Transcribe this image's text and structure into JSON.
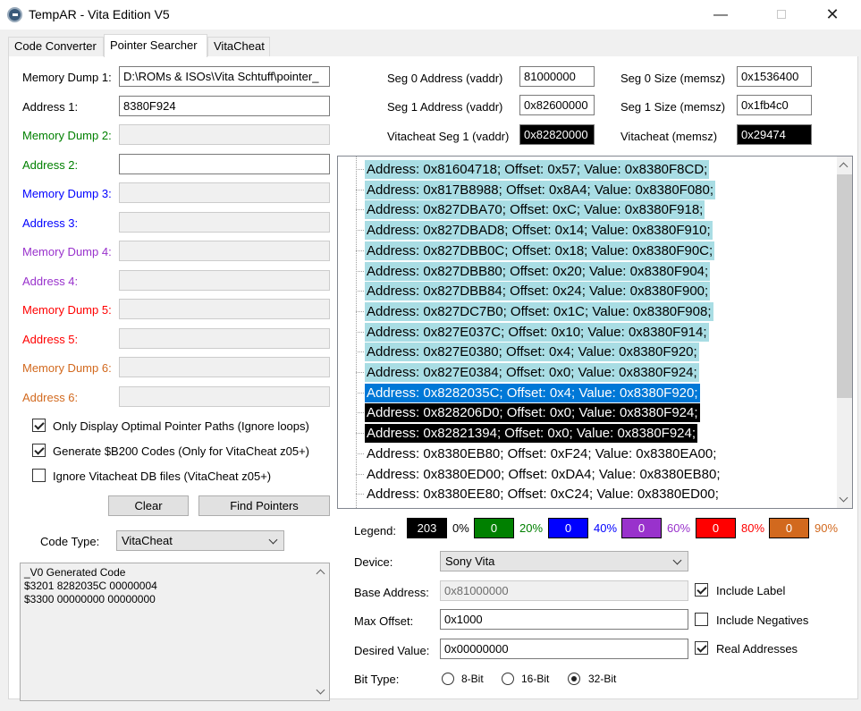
{
  "window": {
    "title": "TempAR - Vita Edition  V5",
    "minimize": "—",
    "close": "✕"
  },
  "tabs": [
    "Code Converter",
    "Pointer Searcher",
    "VitaCheat"
  ],
  "left": {
    "rows": [
      {
        "label": "Memory Dump 1:",
        "value": "D:\\ROMs & ISOs\\Vita Schtuff\\pointer_",
        "color": "#000000",
        "disabled": false
      },
      {
        "label": "Address 1:",
        "value": "8380F924",
        "color": "#000000",
        "disabled": false
      },
      {
        "label": "Memory Dump 2:",
        "value": "",
        "color": "#008000",
        "disabled": true
      },
      {
        "label": "Address 2:",
        "value": "",
        "color": "#008000",
        "disabled": false
      },
      {
        "label": "Memory Dump 3:",
        "value": "",
        "color": "#0000ff",
        "disabled": true
      },
      {
        "label": "Address 3:",
        "value": "",
        "color": "#0000ff",
        "disabled": true
      },
      {
        "label": "Memory Dump 4:",
        "value": "",
        "color": "#9932cc",
        "disabled": true
      },
      {
        "label": "Address 4:",
        "value": "",
        "color": "#9932cc",
        "disabled": true
      },
      {
        "label": "Memory Dump 5:",
        "value": "",
        "color": "#ff0000",
        "disabled": true
      },
      {
        "label": "Address 5:",
        "value": "",
        "color": "#ff0000",
        "disabled": true
      },
      {
        "label": "Memory Dump 6:",
        "value": "",
        "color": "#d2691e",
        "disabled": true
      },
      {
        "label": "Address 6:",
        "value": "",
        "color": "#d2691e",
        "disabled": true
      }
    ],
    "checkboxes": [
      {
        "label": "Only Display Optimal Pointer Paths (Ignore loops)",
        "checked": true
      },
      {
        "label": "Generate $B200 Codes (Only for VitaCheat z05+)",
        "checked": true
      },
      {
        "label": "Ignore Vitacheat DB files (VitaCheat z05+)",
        "checked": false
      }
    ],
    "clear_label": "Clear",
    "find_label": "Find Pointers",
    "code_type_label": "Code Type:",
    "code_type_value": "VitaCheat",
    "code_output": "_V0 Generated Code\n$3201 8282035C 00000004\n$3300 00000000 00000000"
  },
  "segments": {
    "seg0_addr_label": "Seg 0 Address (vaddr)",
    "seg0_addr_value": "81000000",
    "seg0_size_label": "Seg 0 Size (memsz)",
    "seg0_size_value": "0x1536400",
    "seg1_addr_label": "Seg 1 Address (vaddr)",
    "seg1_addr_value": "0x82600000",
    "seg1_size_label": "Seg 1 Size (memsz)",
    "seg1_size_value": "0x1fb4c0",
    "vc_seg1_label": "Vitacheat Seg 1 (vaddr)",
    "vc_seg1_value": "0x82820000",
    "vc_memsz_label": "Vitacheat (memsz)",
    "vc_memsz_value": "0x29474"
  },
  "tree": [
    {
      "text": "Address: 0x81604718; Offset: 0x57; Value: 0x8380F8CD;",
      "style": "hl"
    },
    {
      "text": "Address: 0x817B8988; Offset: 0x8A4; Value: 0x8380F080;",
      "style": "hl"
    },
    {
      "text": "Address: 0x827DBA70; Offset: 0xC; Value: 0x8380F918;",
      "style": "hl"
    },
    {
      "text": "Address: 0x827DBAD8; Offset: 0x14; Value: 0x8380F910;",
      "style": "hl"
    },
    {
      "text": "Address: 0x827DBB0C; Offset: 0x18; Value: 0x8380F90C;",
      "style": "hl"
    },
    {
      "text": "Address: 0x827DBB80; Offset: 0x20; Value: 0x8380F904;",
      "style": "hl"
    },
    {
      "text": "Address: 0x827DBB84; Offset: 0x24; Value: 0x8380F900;",
      "style": "hl"
    },
    {
      "text": "Address: 0x827DC7B0; Offset: 0x1C; Value: 0x8380F908;",
      "style": "hl"
    },
    {
      "text": "Address: 0x827E037C; Offset: 0x10; Value: 0x8380F914;",
      "style": "hl"
    },
    {
      "text": "Address: 0x827E0380; Offset: 0x4; Value: 0x8380F920;",
      "style": "hl"
    },
    {
      "text": "Address: 0x827E0384; Offset: 0x0; Value: 0x8380F924;",
      "style": "hl"
    },
    {
      "text": "Address: 0x8282035C; Offset: 0x4; Value: 0x8380F920;",
      "style": "sel"
    },
    {
      "text": "Address: 0x828206D0; Offset: 0x0; Value: 0x8380F924;",
      "style": "blk"
    },
    {
      "text": "Address: 0x82821394; Offset: 0x0; Value: 0x8380F924;",
      "style": "blk"
    },
    {
      "text": "Address: 0x8380EB80; Offset: 0xF24; Value: 0x8380EA00;",
      "style": ""
    },
    {
      "text": "Address: 0x8380ED00; Offset: 0xDA4; Value: 0x8380EB80;",
      "style": ""
    },
    {
      "text": "Address: 0x8380EE80; Offset: 0xC24; Value: 0x8380ED00;",
      "style": ""
    }
  ],
  "legend": {
    "label": "Legend:",
    "items": [
      {
        "box": "203",
        "pct": "0%",
        "bg": "#000000",
        "pct_color": "#000000"
      },
      {
        "box": "0",
        "pct": "20%",
        "bg": "#008000",
        "pct_color": "#008000"
      },
      {
        "box": "0",
        "pct": "40%",
        "bg": "#0000ff",
        "pct_color": "#0000ff"
      },
      {
        "box": "0",
        "pct": "60%",
        "bg": "#9932cc",
        "pct_color": "#9932cc"
      },
      {
        "box": "0",
        "pct": "80%",
        "bg": "#ff0000",
        "pct_color": "#ff0000"
      },
      {
        "box": "0",
        "pct": "90%",
        "bg": "#d2691e",
        "pct_color": "#d2691e"
      }
    ]
  },
  "settings": {
    "device_label": "Device:",
    "device_value": "Sony Vita",
    "base_label": "Base Address:",
    "base_value": "0x81000000",
    "maxoff_label": "Max Offset:",
    "maxoff_value": "0x1000",
    "desired_label": "Desired Value:",
    "desired_value": "0x00000000",
    "include_label": "Include Label",
    "include_label_checked": true,
    "include_neg": "Include Negatives",
    "include_neg_checked": false,
    "real_addr": "Real Addresses",
    "real_addr_checked": true,
    "bittype_label": "Bit Type:",
    "bit_options": [
      "8-Bit",
      "16-Bit",
      "32-Bit"
    ],
    "bit_selected": "32-Bit"
  }
}
